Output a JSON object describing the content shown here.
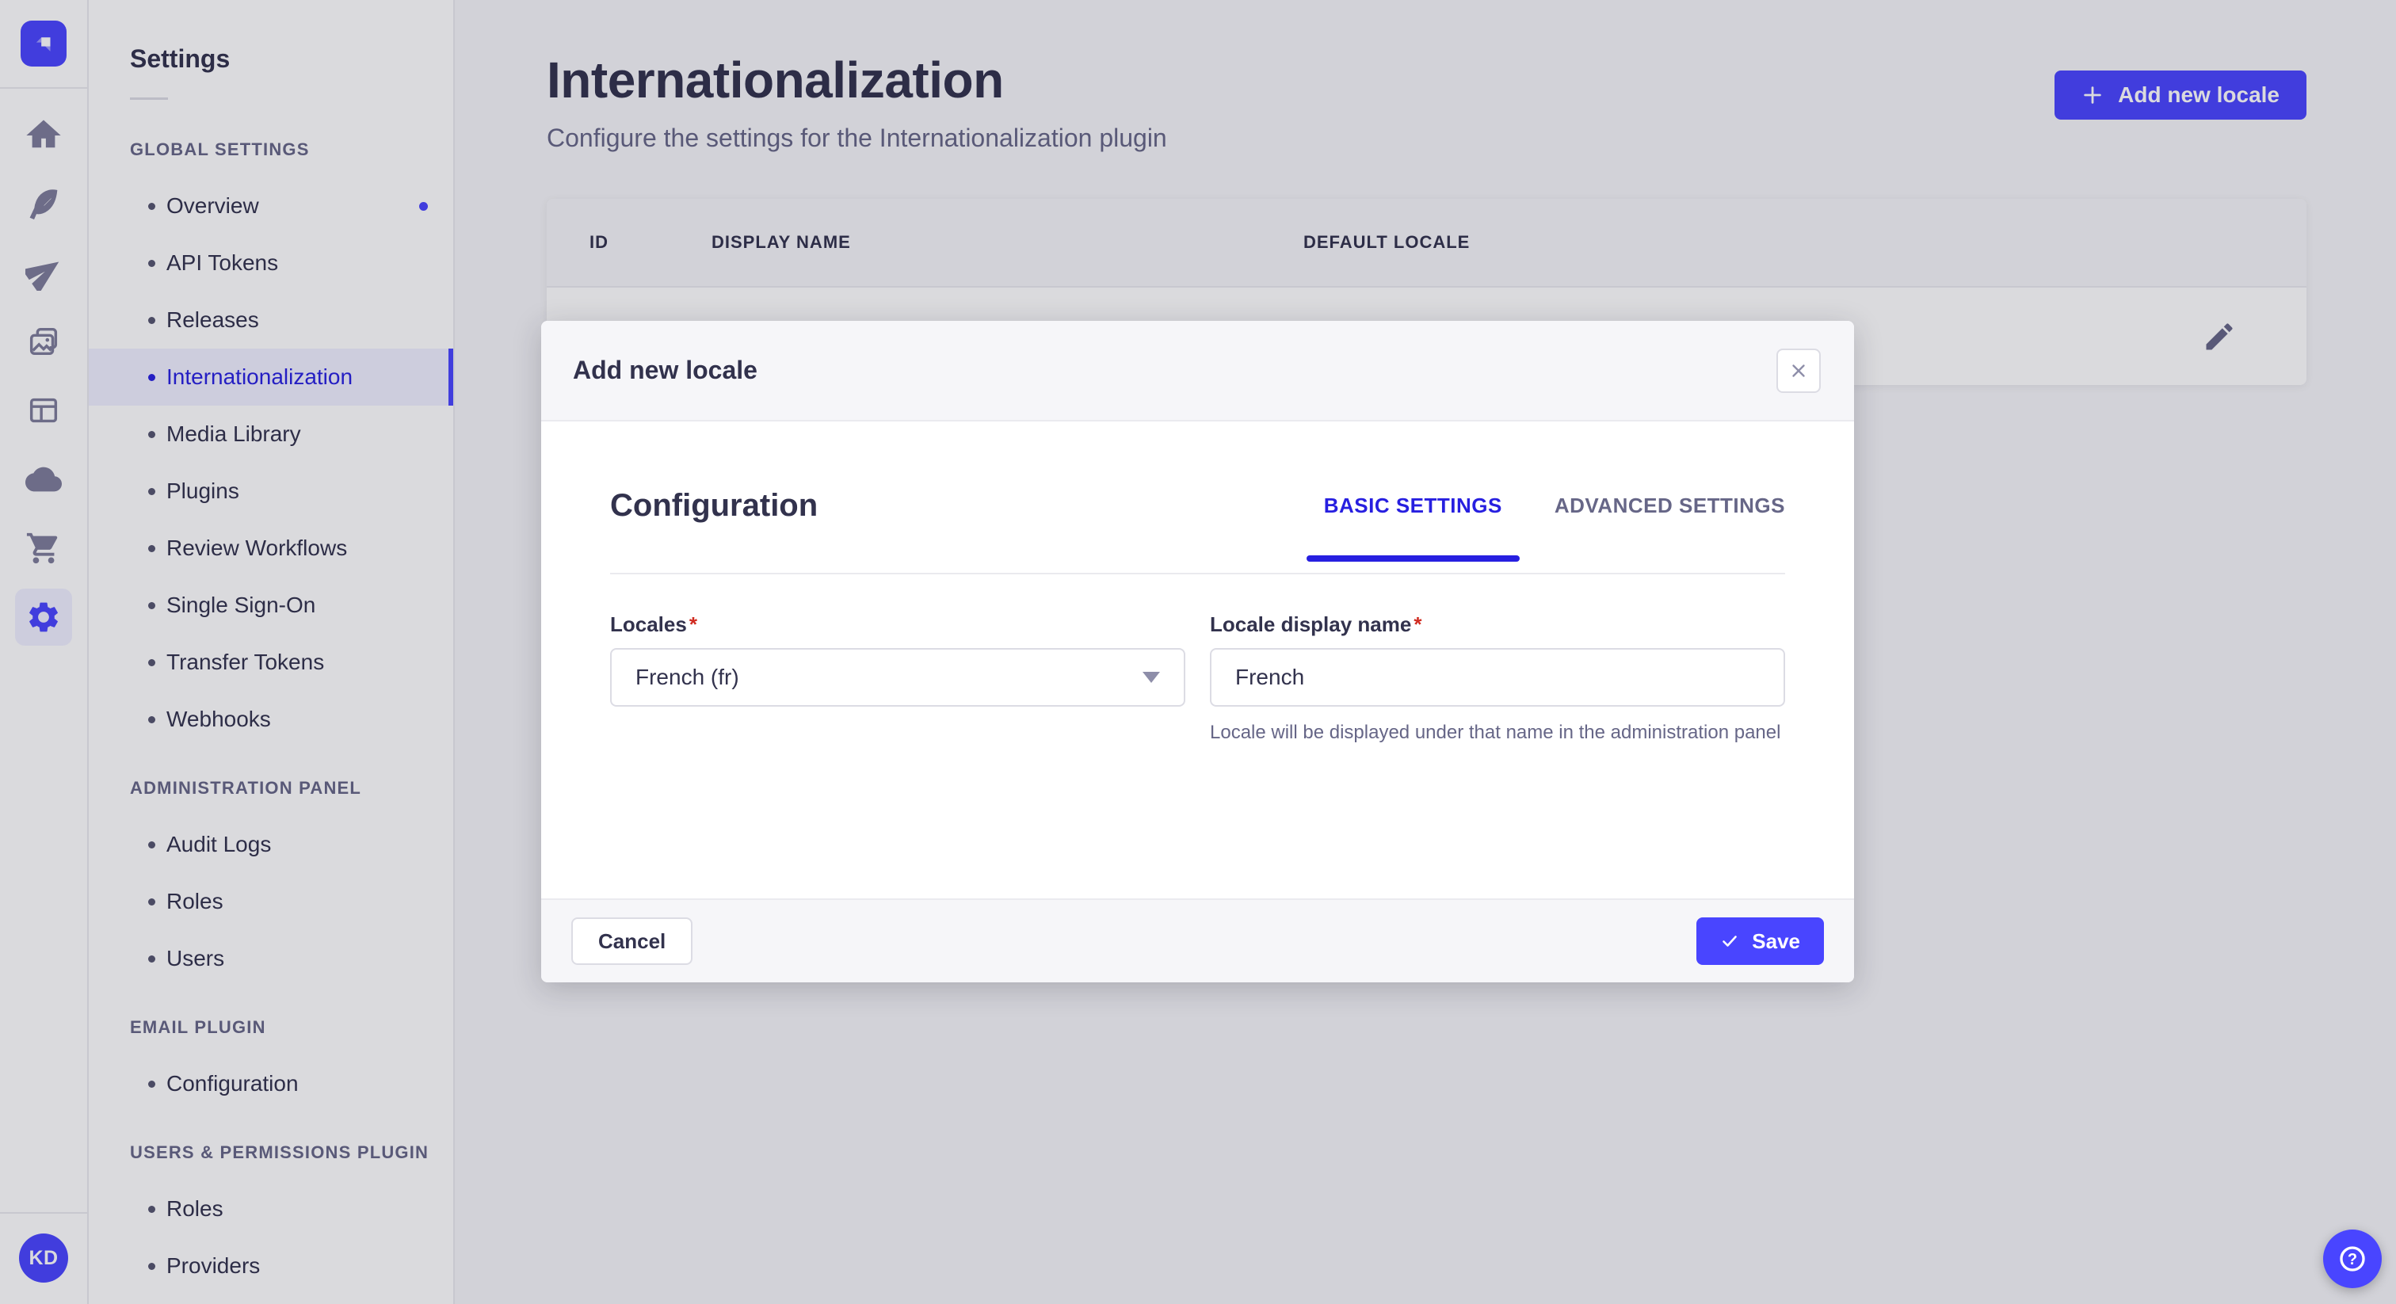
{
  "app": {
    "accent_color": "#4945ff",
    "active_text_color": "#271fe0",
    "text_color": "#32324d",
    "muted_color": "#666687",
    "overlay_color": "rgba(24,24,46,0.16)"
  },
  "rail": {
    "logo_icon": "strapi-logo",
    "icons": [
      "home",
      "feather",
      "paper-plane",
      "media-library",
      "layout",
      "cloud",
      "cart",
      "settings-gear"
    ],
    "active_icon": "settings-gear",
    "avatar_initials": "KD"
  },
  "sidebar": {
    "title": "Settings",
    "sections": [
      {
        "label": "GLOBAL SETTINGS",
        "items": [
          {
            "label": "Overview",
            "notification": true
          },
          {
            "label": "API Tokens"
          },
          {
            "label": "Releases"
          },
          {
            "label": "Internationalization",
            "active": true
          },
          {
            "label": "Media Library"
          },
          {
            "label": "Plugins"
          },
          {
            "label": "Review Workflows"
          },
          {
            "label": "Single Sign-On"
          },
          {
            "label": "Transfer Tokens"
          },
          {
            "label": "Webhooks"
          }
        ]
      },
      {
        "label": "ADMINISTRATION PANEL",
        "items": [
          {
            "label": "Audit Logs"
          },
          {
            "label": "Roles"
          },
          {
            "label": "Users"
          }
        ]
      },
      {
        "label": "EMAIL PLUGIN",
        "items": [
          {
            "label": "Configuration"
          }
        ]
      },
      {
        "label": "USERS & PERMISSIONS PLUGIN",
        "items": [
          {
            "label": "Roles"
          },
          {
            "label": "Providers"
          }
        ]
      }
    ]
  },
  "main": {
    "title": "Internationalization",
    "subtitle": "Configure the settings for the Internationalization plugin",
    "add_button_label": "Add new locale",
    "table": {
      "columns": [
        "ID",
        "DISPLAY NAME",
        "DEFAULT LOCALE"
      ],
      "row_action_icon": "pencil-icon"
    }
  },
  "modal": {
    "title": "Add new locale",
    "close_icon": "close-icon",
    "section_title": "Configuration",
    "tabs": [
      {
        "label": "BASIC SETTINGS",
        "active": true
      },
      {
        "label": "ADVANCED SETTINGS",
        "active": false
      }
    ],
    "fields": {
      "locales": {
        "label": "Locales",
        "required_mark": "*",
        "value": "French (fr)",
        "chevron_icon": "chevron-down-icon"
      },
      "display_name": {
        "label": "Locale display name",
        "required_mark": "*",
        "value": "French",
        "hint": "Locale will be displayed under that name in the administration panel"
      }
    },
    "cancel_label": "Cancel",
    "save_label": "Save",
    "save_icon": "check-icon"
  },
  "fab": {
    "icon": "help-question-icon"
  }
}
